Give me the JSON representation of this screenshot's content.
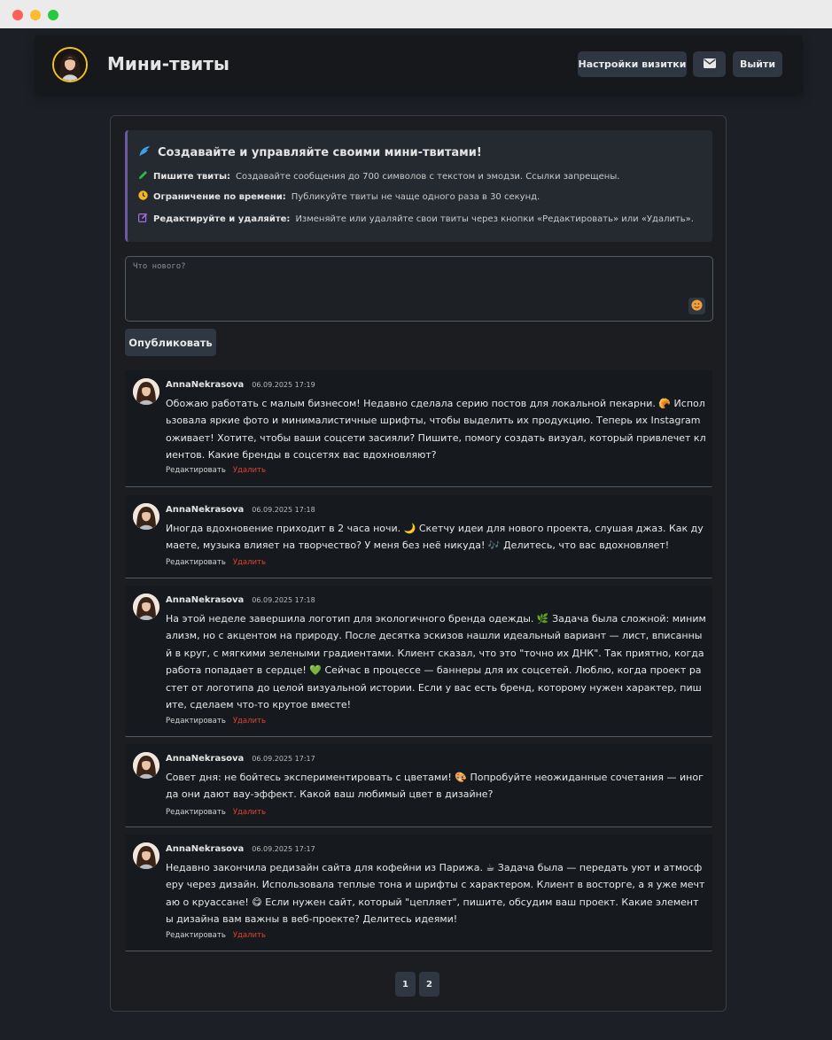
{
  "app": {
    "title": "Мини-твиты"
  },
  "header": {
    "settings_label": "Настройки визитки",
    "mail_icon": "mail-icon",
    "logout_label": "Выйти"
  },
  "info": {
    "title": "Создавайте и управляйте своими мини-твитами!",
    "title_icon": "feather-icon",
    "rows": [
      {
        "icon": "pencil-icon",
        "bold": "Пишите твиты:",
        "text": "Создавайте сообщения до 700 символов с текстом и эмодзи. Ссылки запрещены."
      },
      {
        "icon": "clock-icon",
        "bold": "Ограничение по времени:",
        "text": "Публикуйте твиты не чаще одного раза в 30 секунд."
      },
      {
        "icon": "edit-icon",
        "bold": "Редактируйте и удаляйте:",
        "text": "Изменяйте или удаляйте свои твиты через кнопки «Редактировать» или «Удалить»."
      }
    ]
  },
  "compose": {
    "placeholder": "Что нового?",
    "value": "",
    "publish_label": "Опубликовать"
  },
  "posts": [
    {
      "author": "AnnaNekrasova",
      "date": "06.09.2025 17:19",
      "text": "Обожаю работать с малым бизнесом! Недавно сделала серию постов для локальной пекарни. 🥐 Использовала яркие фото и минималистичные шрифты, чтобы выделить их продукцию. Теперь их Instagram оживает! Хотите, чтобы ваши соцсети засияли? Пишите, помогу создать визуал, который привлечет клиентов. Какие бренды в соцсетях вас вдохновляют?",
      "edit": "Редактировать",
      "delete": "Удалить"
    },
    {
      "author": "AnnaNekrasova",
      "date": "06.09.2025 17:18",
      "text": "Иногда вдохновение приходит в 2 часа ночи. 🌙 Скетчу идеи для нового проекта, слушая джаз. Как думаете, музыка влияет на творчество? У меня без неё никуда! 🎶 Делитесь, что вас вдохновляет!",
      "edit": "Редактировать",
      "delete": "Удалить"
    },
    {
      "author": "AnnaNekrasova",
      "date": "06.09.2025 17:18",
      "text": "На этой неделе завершила логотип для экологичного бренда одежды. 🌿 Задача была сложной: минимализм, но с акцентом на природу. После десятка эскизов нашли идеальный вариант — лист, вписанный в круг, с мягкими зелеными градиентами. Клиент сказал, что это \"точно их ДНК\". Так приятно, когда работа попадает в сердце! 💚 Сейчас в процессе — баннеры для их соцсетей. Люблю, когда проект растет от логотипа до целой визуальной истории. Если у вас есть бренд, которому нужен характер, пишите, сделаем что-то крутое вместе!",
      "edit": "Редактировать",
      "delete": "Удалить"
    },
    {
      "author": "AnnaNekrasova",
      "date": "06.09.2025 17:17",
      "text": "Совет дня: не бойтесь экспериментировать с цветами! 🎨 Попробуйте неожиданные сочетания — иногда они дают вау-эффект. Какой ваш любимый цвет в дизайне?",
      "edit": "Редактировать",
      "delete": "Удалить"
    },
    {
      "author": "AnnaNekrasova",
      "date": "06.09.2025 17:17",
      "text": "Недавно закончила редизайн сайта для кофейни из Парижа. ☕ Задача была — передать уют и атмосферу через дизайн. Использовала теплые тона и шрифты с характером. Клиент в восторге, а я уже мечтаю о круассане! 😋 Если нужен сайт, который \"цепляет\", пишите, обсудим ваш проект. Какие элементы дизайна вам важны в веб-проекте? Делитесь идеями!",
      "edit": "Редактировать",
      "delete": "Удалить"
    }
  ],
  "pagination": [
    "1",
    "2"
  ],
  "colors": {
    "background": "#1c2026",
    "header": "#16181c",
    "button": "#2e3742",
    "accent_border": "#6b5aa3",
    "avatar_ring": "#f4c21a",
    "delete": "#e2432f"
  }
}
